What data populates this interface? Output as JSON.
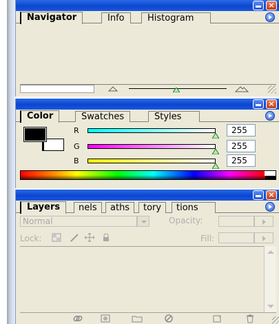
{
  "navigator_panel": {
    "tabs": [
      "Navigator",
      "Info",
      "Histogram"
    ]
  },
  "color_panel": {
    "tabs": [
      "Color",
      "Swatches",
      "Styles"
    ],
    "channels": [
      {
        "label": "R",
        "value": "255",
        "color": "#00ffff"
      },
      {
        "label": "G",
        "value": "255",
        "color": "#ff00ff"
      },
      {
        "label": "B",
        "value": "255",
        "color": "#ffff00"
      }
    ],
    "foreground_color": "#000000",
    "background_color": "#ffffff"
  },
  "layers_panel": {
    "tabs": [
      "Layers",
      "nels",
      "aths",
      "tory",
      "tions"
    ],
    "blend_mode": "Normal",
    "opacity_label": "Opacity:",
    "lock_label": "Lock:",
    "fill_label": "Fill:"
  },
  "theme": {
    "titlebar_blue": "#0a46d0",
    "panel_bg": "#ece9d8"
  }
}
